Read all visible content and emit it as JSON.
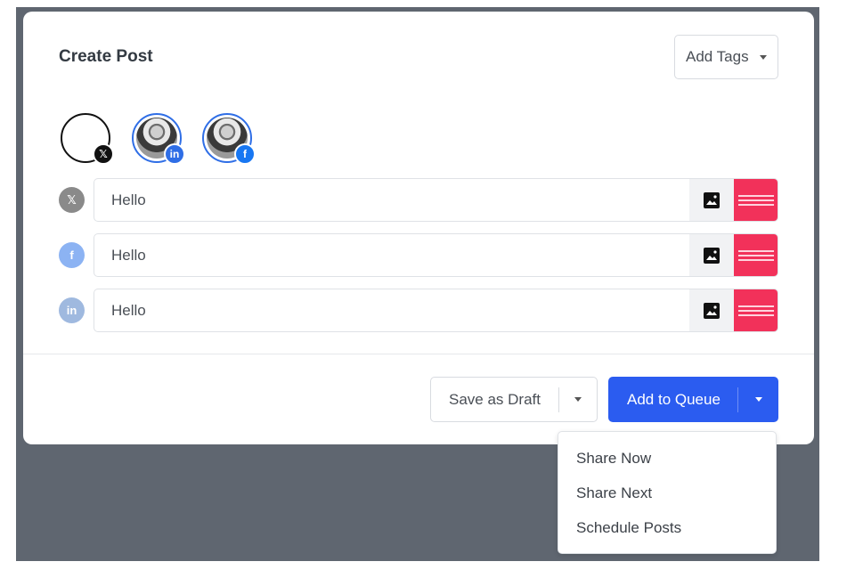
{
  "header": {
    "title": "Create Post",
    "tags_label": "Add Tags"
  },
  "accounts": [
    {
      "network": "x",
      "badge": "𝕏"
    },
    {
      "network": "linkedin",
      "badge": "in"
    },
    {
      "network": "facebook",
      "badge": "f"
    }
  ],
  "posts": [
    {
      "network": "x",
      "icon": "𝕏",
      "text": "Hello"
    },
    {
      "network": "facebook",
      "icon": "f",
      "text": "Hello"
    },
    {
      "network": "linkedin",
      "icon": "in",
      "text": "Hello"
    }
  ],
  "footer": {
    "draft_label": "Save as Draft",
    "queue_label": "Add to Queue"
  },
  "menu": {
    "items": [
      "Share Now",
      "Share Next",
      "Schedule Posts"
    ]
  },
  "colors": {
    "primary": "#2b5cf0",
    "backdrop": "#5f6670",
    "thumb": "#f2315a"
  }
}
